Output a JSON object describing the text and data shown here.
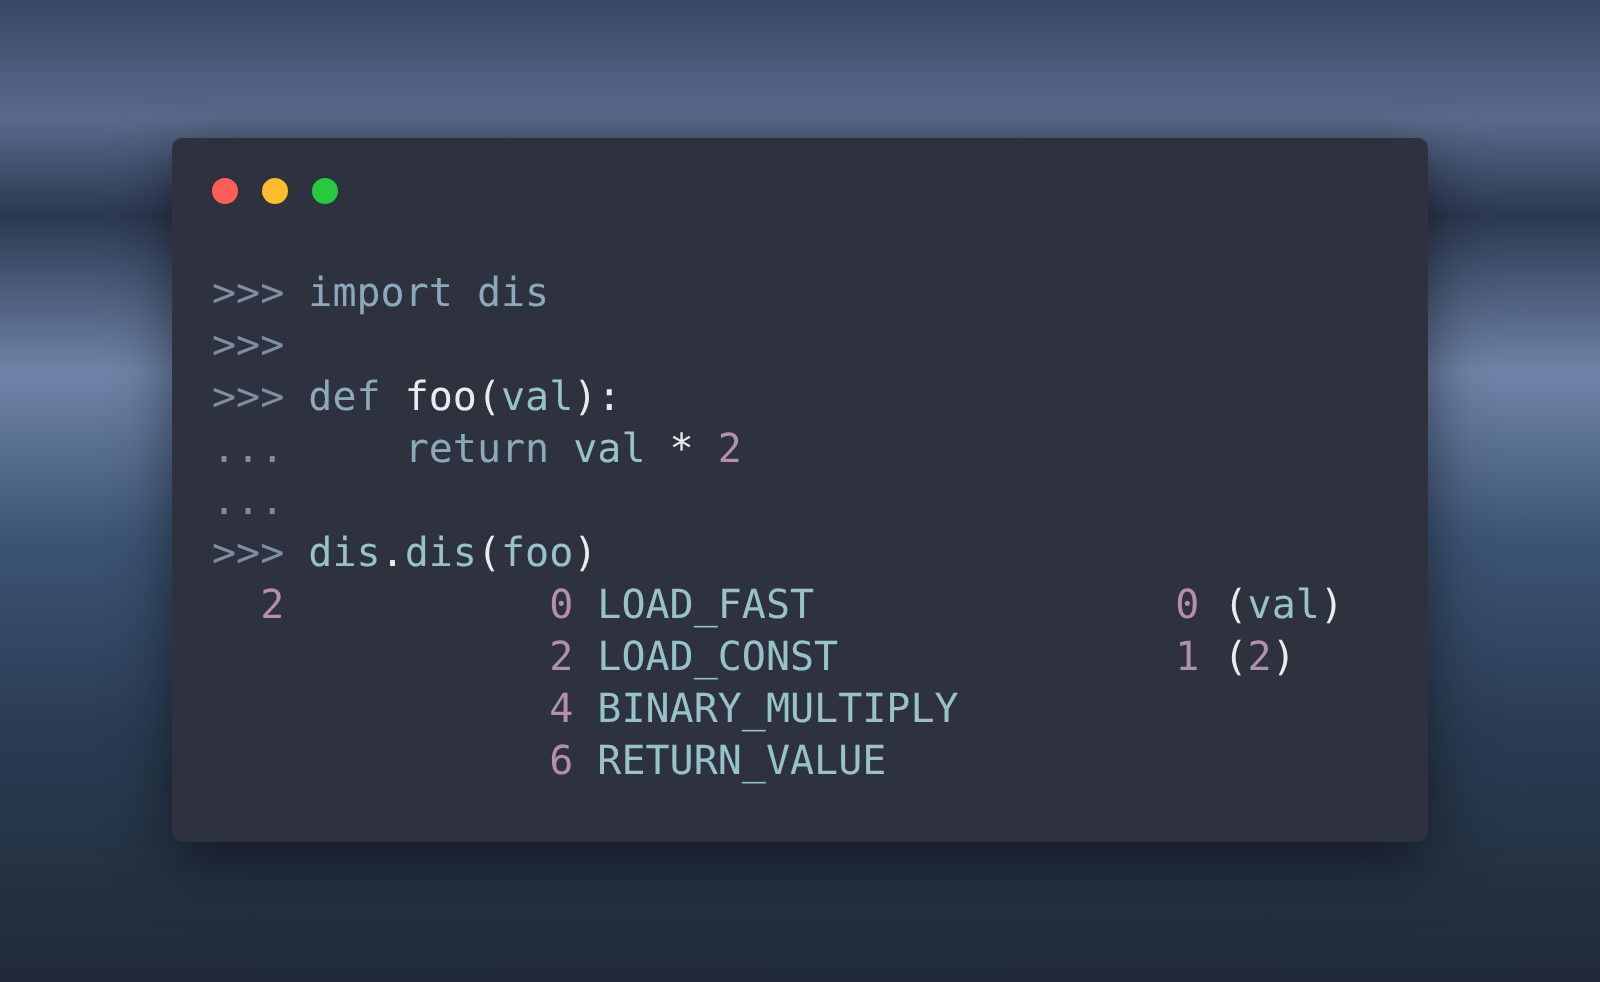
{
  "window": {
    "controls": [
      {
        "color": "#ff5f56"
      },
      {
        "color": "#ffbd2e"
      },
      {
        "color": "#27c93f"
      }
    ]
  },
  "code_lines": [
    {
      "tokens": [
        {
          "kind": "prompt",
          "text": ">>> "
        },
        {
          "kind": "keyword",
          "text": "import dis"
        }
      ]
    },
    {
      "tokens": [
        {
          "kind": "prompt",
          "text": ">>>"
        }
      ]
    },
    {
      "tokens": [
        {
          "kind": "prompt",
          "text": ">>> "
        },
        {
          "kind": "keyword",
          "text": "def "
        },
        {
          "kind": "name",
          "text": "foo("
        },
        {
          "kind": "ident",
          "text": "val"
        },
        {
          "kind": "name",
          "text": "):"
        }
      ]
    },
    {
      "tokens": [
        {
          "kind": "prompt",
          "text": "...     "
        },
        {
          "kind": "keyword",
          "text": "return "
        },
        {
          "kind": "ident",
          "text": "val "
        },
        {
          "kind": "name",
          "text": "* "
        },
        {
          "kind": "number",
          "text": "2"
        }
      ]
    },
    {
      "tokens": [
        {
          "kind": "prompt",
          "text": "..."
        }
      ]
    },
    {
      "tokens": [
        {
          "kind": "prompt",
          "text": ">>> "
        },
        {
          "kind": "ident",
          "text": "dis"
        },
        {
          "kind": "name",
          "text": "."
        },
        {
          "kind": "ident",
          "text": "dis"
        },
        {
          "kind": "name",
          "text": "("
        },
        {
          "kind": "ident",
          "text": "foo"
        },
        {
          "kind": "name",
          "text": ")"
        }
      ]
    },
    {
      "tokens": [
        {
          "kind": "number",
          "text": "  2           0 "
        },
        {
          "kind": "ident",
          "text": "LOAD_FAST               "
        },
        {
          "kind": "number",
          "text": "0 "
        },
        {
          "kind": "name",
          "text": "("
        },
        {
          "kind": "ident",
          "text": "val"
        },
        {
          "kind": "name",
          "text": ")"
        }
      ]
    },
    {
      "tokens": [
        {
          "kind": "number",
          "text": "              2 "
        },
        {
          "kind": "ident",
          "text": "LOAD_CONST              "
        },
        {
          "kind": "number",
          "text": "1 "
        },
        {
          "kind": "name",
          "text": "("
        },
        {
          "kind": "number",
          "text": "2"
        },
        {
          "kind": "name",
          "text": ")"
        }
      ]
    },
    {
      "tokens": [
        {
          "kind": "number",
          "text": "              4 "
        },
        {
          "kind": "ident",
          "text": "BINARY_MULTIPLY"
        }
      ]
    },
    {
      "tokens": [
        {
          "kind": "number",
          "text": "              6 "
        },
        {
          "kind": "ident",
          "text": "RETURN_VALUE"
        }
      ]
    }
  ]
}
